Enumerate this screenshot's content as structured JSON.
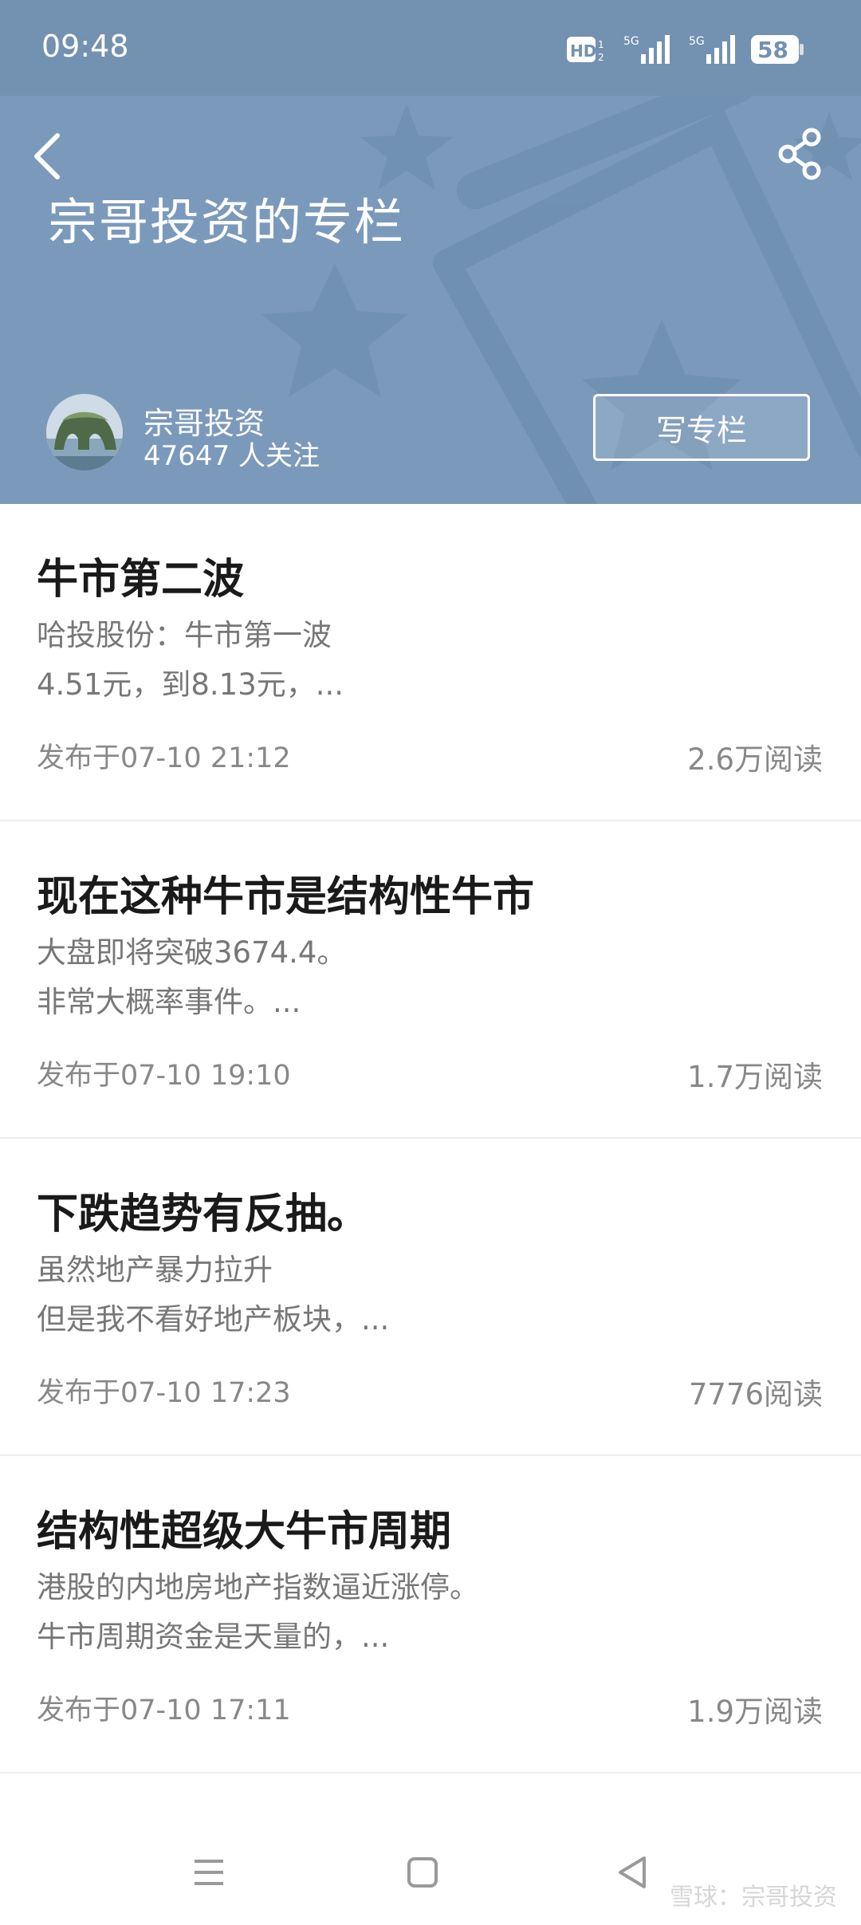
{
  "status_bar": {
    "time": "09:48",
    "battery": "58"
  },
  "header": {
    "title": "宗哥投资的专栏",
    "author_name": "宗哥投资",
    "followers": "47647 人关注",
    "write_button": "写专栏",
    "background_color": "#7b9abb"
  },
  "articles": [
    {
      "title": "牛市第二波",
      "line1": "哈投股份：牛市第一波",
      "line2": "4.51元，到8.13元，...",
      "date": "发布于07-10 21:12",
      "reads": "2.6万阅读"
    },
    {
      "title": "现在这种牛市是结构性牛市",
      "line1": "大盘即将突破3674.4。",
      "line2": "非常大概率事件。...",
      "date": "发布于07-10 19:10",
      "reads": "1.7万阅读"
    },
    {
      "title": "下跌趋势有反抽。",
      "line1": "虽然地产暴力拉升",
      "line2": "但是我不看好地产板块，...",
      "date": "发布于07-10 17:23",
      "reads": "7776阅读"
    },
    {
      "title": "结构性超级大牛市周期",
      "line1": "港股的内地房地产指数逼近涨停。",
      "line2": "牛市周期资金是天量的，...",
      "date": "发布于07-10 17:11",
      "reads": "1.9万阅读"
    }
  ],
  "watermark": "雪球：宗哥投资"
}
